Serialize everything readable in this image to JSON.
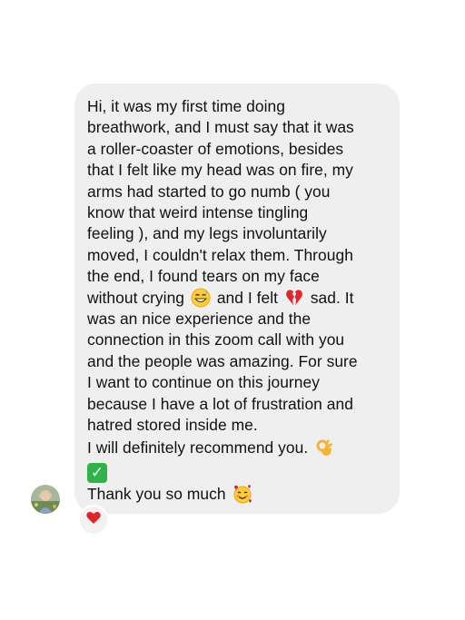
{
  "message": {
    "lines_part1": "Hi, it was my first time doing\nbreathwork, and I must say that it was\na roller-coaster of emotions, besides\nthat I felt like my head was on fire, my\narms had started to go numb ( you\nknow that weird intense tingling\nfeeling ), and my legs involuntarily\nmoved, I couldn't relax them. Through\nthe end, I found tears on my face\nwithout crying",
    "text_and_i_felt": "and I felt",
    "text_sad": "sad. It",
    "lines_part2": "was an nice experience and the\nconnection in this zoom call with you\nand the people  was amazing. For sure\nI want to continue on this journey\nbecause I have a lot of frustration and\nhatred stored inside me.",
    "recommend": "I will definitely recommend you.",
    "thank_you": "Thank you so much",
    "emoji_sweat_smile": "grinning-sweat-emoji",
    "emoji_broken_heart": "broken-heart-emoji",
    "emoji_ok_hand": "ok-hand-emoji",
    "emoji_check": "check-mark-button-emoji",
    "emoji_hearts_face": "smiling-face-with-hearts-emoji"
  },
  "reaction": {
    "icon": "red-heart-icon",
    "color": "#e0242c"
  },
  "colors": {
    "bubble_bg": "#efefef",
    "text": "#111111"
  }
}
